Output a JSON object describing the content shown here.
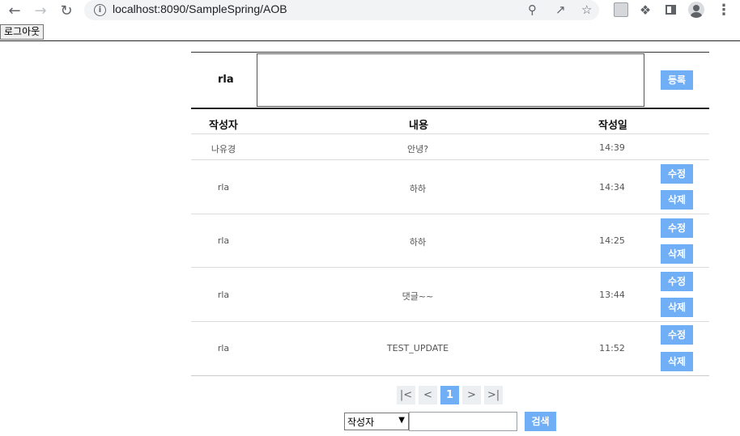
{
  "browser": {
    "url": "localhost:8090/SampleSpring/AOB"
  },
  "logout_label": "로그아웃",
  "comment_form": {
    "writer": "rla",
    "content_value": "",
    "register_label": "등록"
  },
  "table": {
    "headers": {
      "writer": "작성자",
      "content": "내용",
      "date": "작성일"
    },
    "rows": [
      {
        "writer": "나유경",
        "content": "안녕?",
        "date": "14:39"
      },
      {
        "writer": "rla",
        "content": "하하",
        "date": "14:34",
        "edit": "수정",
        "delete": "삭제"
      },
      {
        "writer": "rla",
        "content": "하하",
        "date": "14:25",
        "edit": "수정",
        "delete": "삭제"
      },
      {
        "writer": "rla",
        "content": "댓글~~",
        "date": "13:44",
        "edit": "수정",
        "delete": "삭제"
      },
      {
        "writer": "rla",
        "content": "TEST_UPDATE",
        "date": "11:52",
        "edit": "수정",
        "delete": "삭제"
      }
    ]
  },
  "pagination": {
    "first": "|<",
    "prev": "<",
    "current": "1",
    "next": ">",
    "last": ">|"
  },
  "search": {
    "selected_option": "작성자",
    "query": "",
    "button_label": "검색"
  },
  "colors": {
    "accent": "#70aef6"
  }
}
